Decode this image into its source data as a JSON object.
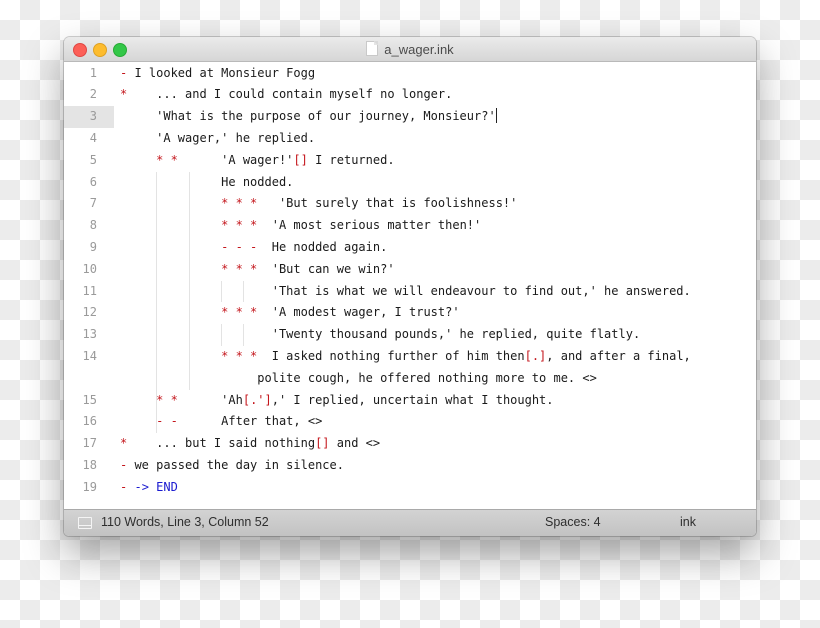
{
  "window": {
    "title": "a_wager.ink",
    "controls": [
      "close",
      "minimize",
      "zoom"
    ]
  },
  "editor": {
    "current_line": 3,
    "lines": [
      {
        "n": "1",
        "segs": [
          {
            "t": "-",
            "c": "red"
          },
          {
            "t": " I looked at Monsieur Fogg"
          }
        ]
      },
      {
        "n": "2",
        "segs": [
          {
            "t": "*",
            "c": "red"
          },
          {
            "t": "    ... and I could contain myself no longer."
          }
        ]
      },
      {
        "n": "3",
        "segs": [
          {
            "t": "     'What is the purpose of our journey, Monsieur?'"
          }
        ],
        "caret": true
      },
      {
        "n": "4",
        "segs": [
          {
            "t": "     'A wager,' he replied."
          }
        ]
      },
      {
        "n": "5",
        "segs": [
          {
            "t": "     "
          },
          {
            "t": "* *",
            "c": "red"
          },
          {
            "t": "      'A wager!'"
          },
          {
            "t": "[]",
            "c": "red"
          },
          {
            "t": " I returned."
          }
        ]
      },
      {
        "n": "6",
        "segs": [
          {
            "t": "              He nodded."
          }
        ]
      },
      {
        "n": "7",
        "segs": [
          {
            "t": "              "
          },
          {
            "t": "* * *",
            "c": "red"
          },
          {
            "t": "   'But surely that is foolishness!'"
          }
        ]
      },
      {
        "n": "8",
        "segs": [
          {
            "t": "              "
          },
          {
            "t": "* * *",
            "c": "red"
          },
          {
            "t": "  'A most serious matter then!'"
          }
        ]
      },
      {
        "n": "9",
        "segs": [
          {
            "t": "              "
          },
          {
            "t": "- - -",
            "c": "red"
          },
          {
            "t": "  He nodded again."
          }
        ]
      },
      {
        "n": "10",
        "segs": [
          {
            "t": "              "
          },
          {
            "t": "* * *",
            "c": "red"
          },
          {
            "t": "  'But can we win?'"
          }
        ]
      },
      {
        "n": "11",
        "segs": [
          {
            "t": "                     'That is what we will endeavour to find out,' he answered."
          }
        ]
      },
      {
        "n": "12",
        "segs": [
          {
            "t": "              "
          },
          {
            "t": "* * *",
            "c": "red"
          },
          {
            "t": "  'A modest wager, I trust?'"
          }
        ]
      },
      {
        "n": "13",
        "segs": [
          {
            "t": "                     'Twenty thousand pounds,' he replied, quite flatly."
          }
        ]
      },
      {
        "n": "14",
        "segs": [
          {
            "t": "              "
          },
          {
            "t": "* * *",
            "c": "red"
          },
          {
            "t": "  I asked nothing further of him then"
          },
          {
            "t": "[.]",
            "c": "red"
          },
          {
            "t": ", and after a final,"
          }
        ]
      },
      {
        "n": "",
        "segs": [
          {
            "t": "                   polite cough, he offered nothing more to me. <>"
          }
        ]
      },
      {
        "n": "15",
        "segs": [
          {
            "t": "     "
          },
          {
            "t": "* *",
            "c": "red"
          },
          {
            "t": "      'Ah"
          },
          {
            "t": "[.']",
            "c": "red"
          },
          {
            "t": ",' I replied, uncertain what I thought."
          }
        ]
      },
      {
        "n": "16",
        "segs": [
          {
            "t": "     "
          },
          {
            "t": "- -",
            "c": "red"
          },
          {
            "t": "      After that, <>"
          }
        ]
      },
      {
        "n": "17",
        "segs": [
          {
            "t": "*",
            "c": "red"
          },
          {
            "t": "    ... but I said nothing"
          },
          {
            "t": "[]",
            "c": "red"
          },
          {
            "t": " and <>"
          }
        ]
      },
      {
        "n": "18",
        "segs": [
          {
            "t": "-",
            "c": "red"
          },
          {
            "t": " we passed the day in silence."
          }
        ]
      },
      {
        "n": "19",
        "segs": [
          {
            "t": "-",
            "c": "red"
          },
          {
            "t": " "
          },
          {
            "t": "-> END",
            "c": "blue"
          }
        ]
      }
    ]
  },
  "statusbar": {
    "panel_icon": "panel-toggle-icon",
    "position_text": "110 Words, Line 3, Column 52",
    "indent_text": "Spaces: 4",
    "syntax_text": "ink"
  }
}
